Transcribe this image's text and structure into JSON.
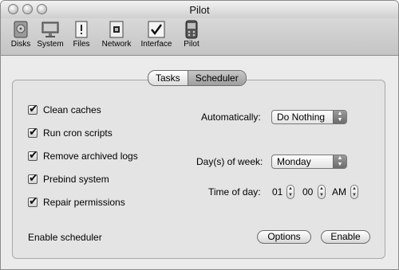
{
  "window": {
    "title": "Pilot"
  },
  "toolbar": {
    "items": [
      {
        "label": "Disks",
        "icon": "disk-icon"
      },
      {
        "label": "System",
        "icon": "monitor-icon"
      },
      {
        "label": "Files",
        "icon": "files-icon"
      },
      {
        "label": "Network",
        "icon": "network-icon"
      },
      {
        "label": "Interface",
        "icon": "checkbox-icon"
      },
      {
        "label": "Pilot",
        "icon": "pilot-icon"
      }
    ]
  },
  "tabs": {
    "tasks": "Tasks",
    "scheduler": "Scheduler",
    "selected": "Scheduler"
  },
  "tasks": [
    {
      "label": "Clean caches",
      "checked": true
    },
    {
      "label": "Run cron scripts",
      "checked": true
    },
    {
      "label": "Remove archived logs",
      "checked": true
    },
    {
      "label": "Prebind system",
      "checked": true
    },
    {
      "label": "Repair permissions",
      "checked": true
    }
  ],
  "automatically": {
    "label": "Automatically:",
    "value": "Do Nothing"
  },
  "days": {
    "label": "Day(s) of week:",
    "value": "Monday"
  },
  "time": {
    "label": "Time of day:",
    "hour": "01",
    "minute": "00",
    "ampm": "AM"
  },
  "footer": {
    "enable_label": "Enable scheduler",
    "options_button": "Options",
    "enable_button": "Enable"
  }
}
